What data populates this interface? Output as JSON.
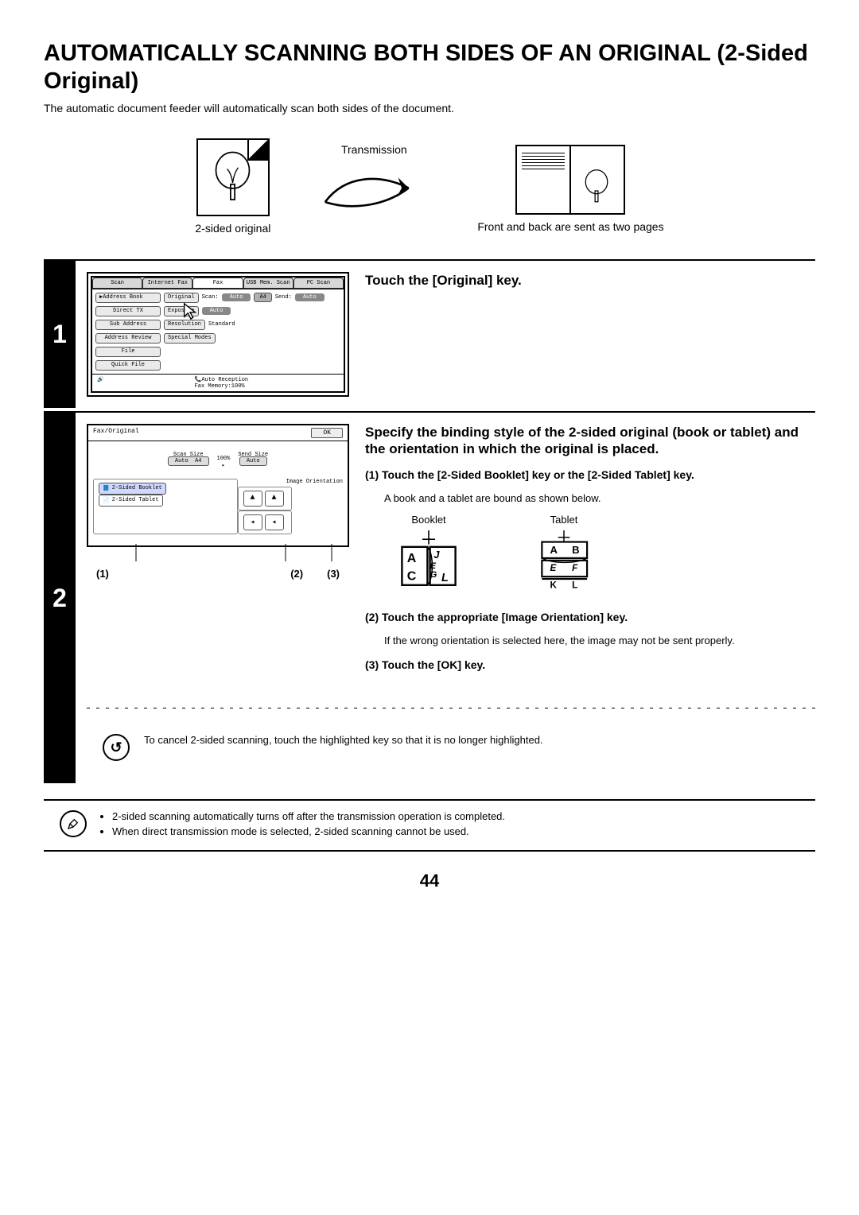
{
  "title": "AUTOMATICALLY SCANNING BOTH SIDES OF AN ORIGINAL (2-Sided Original)",
  "intro": "The automatic document feeder will automatically scan both sides of the document.",
  "diagram": {
    "left_caption": "2-sided original",
    "transmission_label": "Transmission",
    "right_caption": "Front and back are sent as two pages"
  },
  "step1": {
    "number": "1",
    "title": "Touch the [Original] key.",
    "screen": {
      "tabs": [
        "Scan",
        "Internet Fax",
        "Fax",
        "USB Mem. Scan",
        "PC Scan"
      ],
      "left_buttons": [
        "Address Book",
        "Direct TX",
        "Sub Address",
        "Address Review",
        "File",
        "Quick File"
      ],
      "row1": {
        "original": "Original",
        "scan_label": "Scan:",
        "auto": "Auto",
        "size": "A4",
        "send_label": "Send:",
        "send_auto": "Auto"
      },
      "row2": {
        "exposure": "Exposure",
        "auto": "Auto"
      },
      "row3": {
        "resolution": "Resolution",
        "standard": "Standard"
      },
      "row4": {
        "special": "Special Modes"
      },
      "status": {
        "auto_reception": "Auto Reception",
        "fax_memory": "Fax Memory:100%"
      }
    }
  },
  "step2": {
    "number": "2",
    "title": "Specify the binding style of the 2-sided original (book or tablet) and the orientation in which the original is placed.",
    "sub1_label": "(1)",
    "sub1_text": "Touch the [2-Sided Booklet] key or the [2-Sided Tablet] key.",
    "sub1_note": "A book and a tablet are bound as shown below.",
    "booklet_label": "Booklet",
    "tablet_label": "Tablet",
    "sub2_label": "(2)",
    "sub2_text": "Touch the appropriate [Image Orientation] key.",
    "sub2_note": "If the wrong orientation is selected here, the image may not be sent properly.",
    "sub3_label": "(3)",
    "sub3_text": "Touch the [OK] key.",
    "screen": {
      "titlebar": "Fax/Original",
      "ok": "OK",
      "scan_size_label": "Scan Size",
      "percent": "100%",
      "send_size_label": "Send Size",
      "auto": "Auto",
      "a4": "A4",
      "booklet_btn": "2-Sided Booklet",
      "tablet_btn": "2-Sided Tablet",
      "orient_label": "Image Orientation"
    },
    "callouts": {
      "c1": "(1)",
      "c2": "(2)",
      "c3": "(3)"
    },
    "cancel_note": "To cancel 2-sided scanning, touch the highlighted key so that it is no longer highlighted."
  },
  "footer_notes": {
    "n1": "2-sided scanning automatically turns off after the transmission operation is completed.",
    "n2": "When direct transmission mode is selected, 2-sided scanning cannot be used."
  },
  "page_number": "44"
}
